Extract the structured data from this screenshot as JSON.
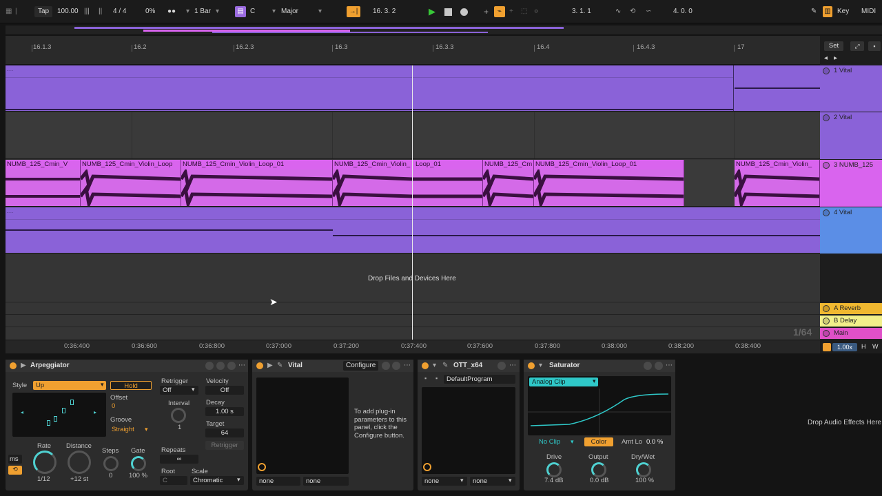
{
  "transport": {
    "tap": "Tap",
    "tempo": "100.00",
    "signature": "4 / 4",
    "swing": "0%",
    "quantize": "1 Bar",
    "key_root": "C",
    "key_scale": "Major",
    "position": "16.  3.  2",
    "loop_start": "3.  1.  1",
    "loop_length": "4.  0.  0",
    "key_label": "Key",
    "midi_label": "MIDI"
  },
  "ruler": {
    "labels": [
      "16.1.3",
      "16.2",
      "16.2.3",
      "16.3",
      "16.3.3",
      "16.4",
      "16.4.3",
      "17"
    ],
    "set_label": "Set"
  },
  "time_axis": [
    "0:36:400",
    "0:36:600",
    "0:36:800",
    "0:37:000",
    "0:37:200",
    "0:37:400",
    "0:37:600",
    "0:37:800",
    "0:38:000",
    "0:38:200",
    "0:38:400"
  ],
  "tracks": [
    {
      "name": "1 Vital",
      "color": "#8a62d8"
    },
    {
      "name": "2 Vital",
      "color": "#8a62d8"
    },
    {
      "name": "3 NUMB_125",
      "color": "#d964ee"
    },
    {
      "name": "4 Vital",
      "color": "#5b8ee6"
    }
  ],
  "audio_clips": [
    "NUMB_125_Cmin_V",
    "NUMB_125_Cmin_Violin_Loop",
    "NUMB_125_Cmin_Violin_Loop_01",
    "NUMB_125_Cmin_Violin_",
    "Loop_01",
    "NUMB_125_Cm",
    "NUMB_125_Cmin_Violin_Loop_01",
    "NUMB_125_Cmin_Violin_"
  ],
  "drop_text": "Drop Files and Devices Here",
  "returns": [
    {
      "name": "A Reverb",
      "color": "#f0b830"
    },
    {
      "name": "B Delay",
      "color": "#f2f08a"
    },
    {
      "name": "Main",
      "color": "#e050c8"
    }
  ],
  "grid_label": "1/64",
  "zoom_label": "1.00x",
  "arpeggiator": {
    "title": "Arpeggiator",
    "style_label": "Style",
    "style_value": "Up",
    "hold": "Hold",
    "offset_label": "Offset",
    "offset_value": "0",
    "groove_label": "Groove",
    "groove_value": "Straight",
    "retrigger_label": "Retrigger",
    "retrigger_value": "Off",
    "interval_label": "Interval",
    "interval_value": "1",
    "repeats_label": "Repeats",
    "repeats_value": "∞",
    "velocity_label": "Velocity",
    "velocity_value": "Off",
    "decay_label": "Decay",
    "decay_value": "1.00 s",
    "target_label": "Target",
    "target_value": "64",
    "retrigger_btn": "Retrigger",
    "rate_label": "Rate",
    "rate_value": "1/12",
    "distance_label": "Distance",
    "distance_value": "+12 st",
    "steps_label": "Steps",
    "steps_value": "0",
    "gate_label": "Gate",
    "gate_value": "100 %",
    "ms_label": "ms",
    "root_label": "Root",
    "root_value": "C",
    "scale_label": "Scale",
    "scale_value": "Chromatic"
  },
  "vital": {
    "title": "Vital",
    "configure": "Configure",
    "hint": "To add plug-in parameters to this panel, click the Configure button.",
    "slot1": "none",
    "slot2": "none"
  },
  "ott": {
    "title": "OTT_x64",
    "program": "DefaultProgram",
    "slot1": "none",
    "slot2": "none"
  },
  "saturator": {
    "title": "Saturator",
    "mode": "Analog Clip",
    "clip": "No Clip",
    "color_btn": "Color",
    "lo_label": "Amt Lo",
    "lo_value": "0.0 %",
    "drive_label": "Drive",
    "drive_value": "7.4 dB",
    "output_label": "Output",
    "output_value": "0.0 dB",
    "drywet_label": "Dry/Wet",
    "drywet_value": "100 %"
  },
  "drop_effects": "Drop Audio Effects Here"
}
